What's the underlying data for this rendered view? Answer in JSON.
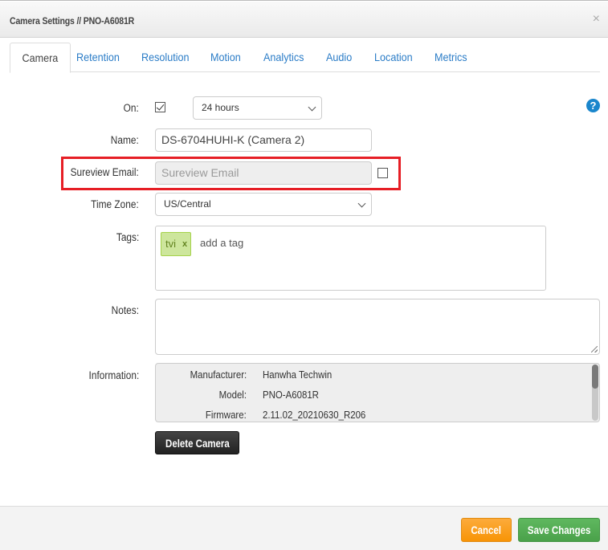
{
  "header": {
    "title": "Camera Settings // PNO-A6081R",
    "close_icon": "×"
  },
  "tabs": [
    {
      "label": "Camera",
      "active": true
    },
    {
      "label": "Retention",
      "active": false
    },
    {
      "label": "Resolution",
      "active": false
    },
    {
      "label": "Motion",
      "active": false
    },
    {
      "label": "Analytics",
      "active": false
    },
    {
      "label": "Audio",
      "active": false
    },
    {
      "label": "Location",
      "active": false
    },
    {
      "label": "Metrics",
      "active": false
    }
  ],
  "form": {
    "on": {
      "label": "On:",
      "checked": true,
      "schedule_value": "24 hours"
    },
    "name": {
      "label": "Name:",
      "value": "DS-6704HUHI-K (Camera 2)"
    },
    "sureview_email": {
      "label": "Sureview Email:",
      "placeholder": "Sureview Email",
      "checked": false
    },
    "time_zone": {
      "label": "Time Zone:",
      "value": "US/Central"
    },
    "tags": {
      "label": "Tags:",
      "items": [
        {
          "text": "tvi",
          "remove": "x"
        }
      ],
      "placeholder": "add a tag"
    },
    "notes": {
      "label": "Notes:",
      "value": ""
    },
    "information": {
      "label": "Information:",
      "rows": [
        {
          "key": "Manufacturer:",
          "value": "Hanwha Techwin"
        },
        {
          "key": "Model:",
          "value": "PNO-A6081R"
        },
        {
          "key": "Firmware:",
          "value": "2.11.02_20210630_R206"
        }
      ]
    },
    "help_icon": "?"
  },
  "buttons": {
    "delete": "Delete Camera",
    "cancel": "Cancel",
    "save": "Save Changes"
  },
  "colors": {
    "link": "#2a7cc7",
    "highlight": "#e61e25",
    "cancel": "#f89406",
    "save": "#4aa14a",
    "tag_bg": "#cde69c"
  }
}
